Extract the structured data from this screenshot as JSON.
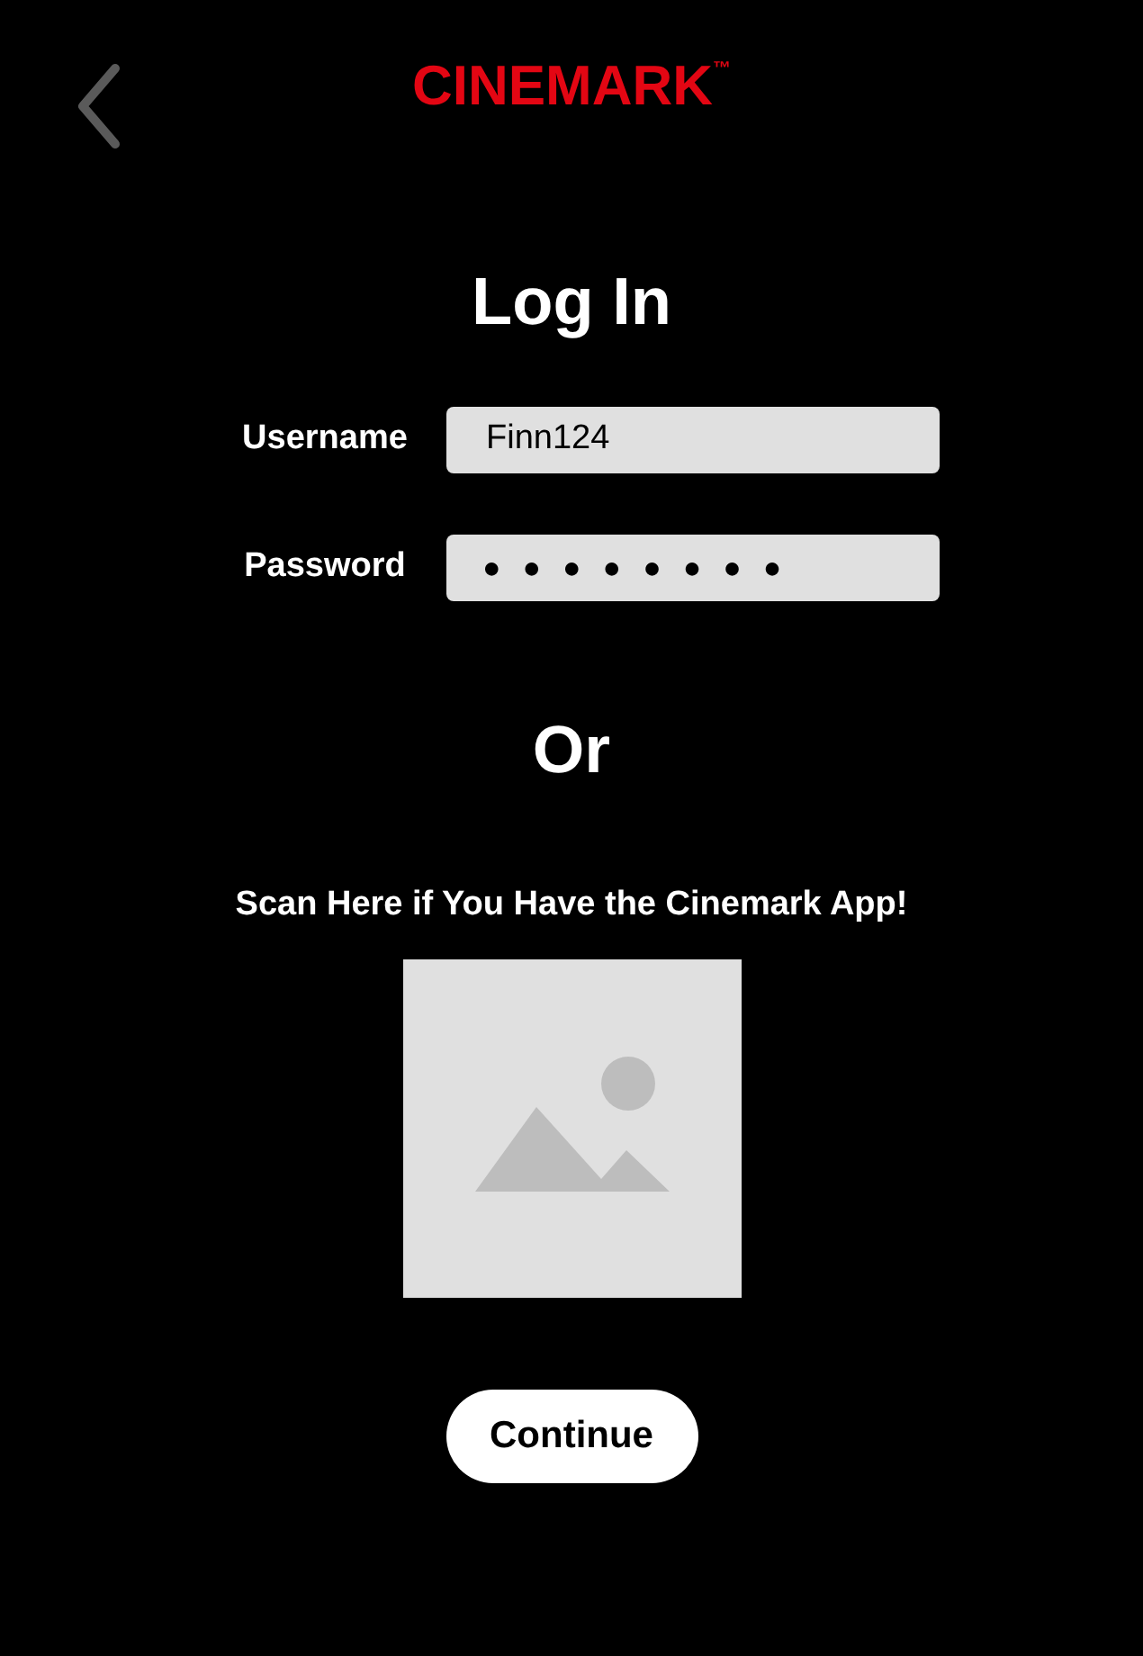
{
  "header": {
    "logo": "CINEMARK",
    "trademark": "™"
  },
  "title": "Log In",
  "fields": [
    {
      "label": "Username",
      "value": "Finn124",
      "kind": "text"
    },
    {
      "label": "Password",
      "value": "●●●●●●●●",
      "kind": "masked"
    }
  ],
  "separator": "Or",
  "scan": {
    "text": "Scan Here if You Have the Cinemark App!"
  },
  "button": "Continue"
}
